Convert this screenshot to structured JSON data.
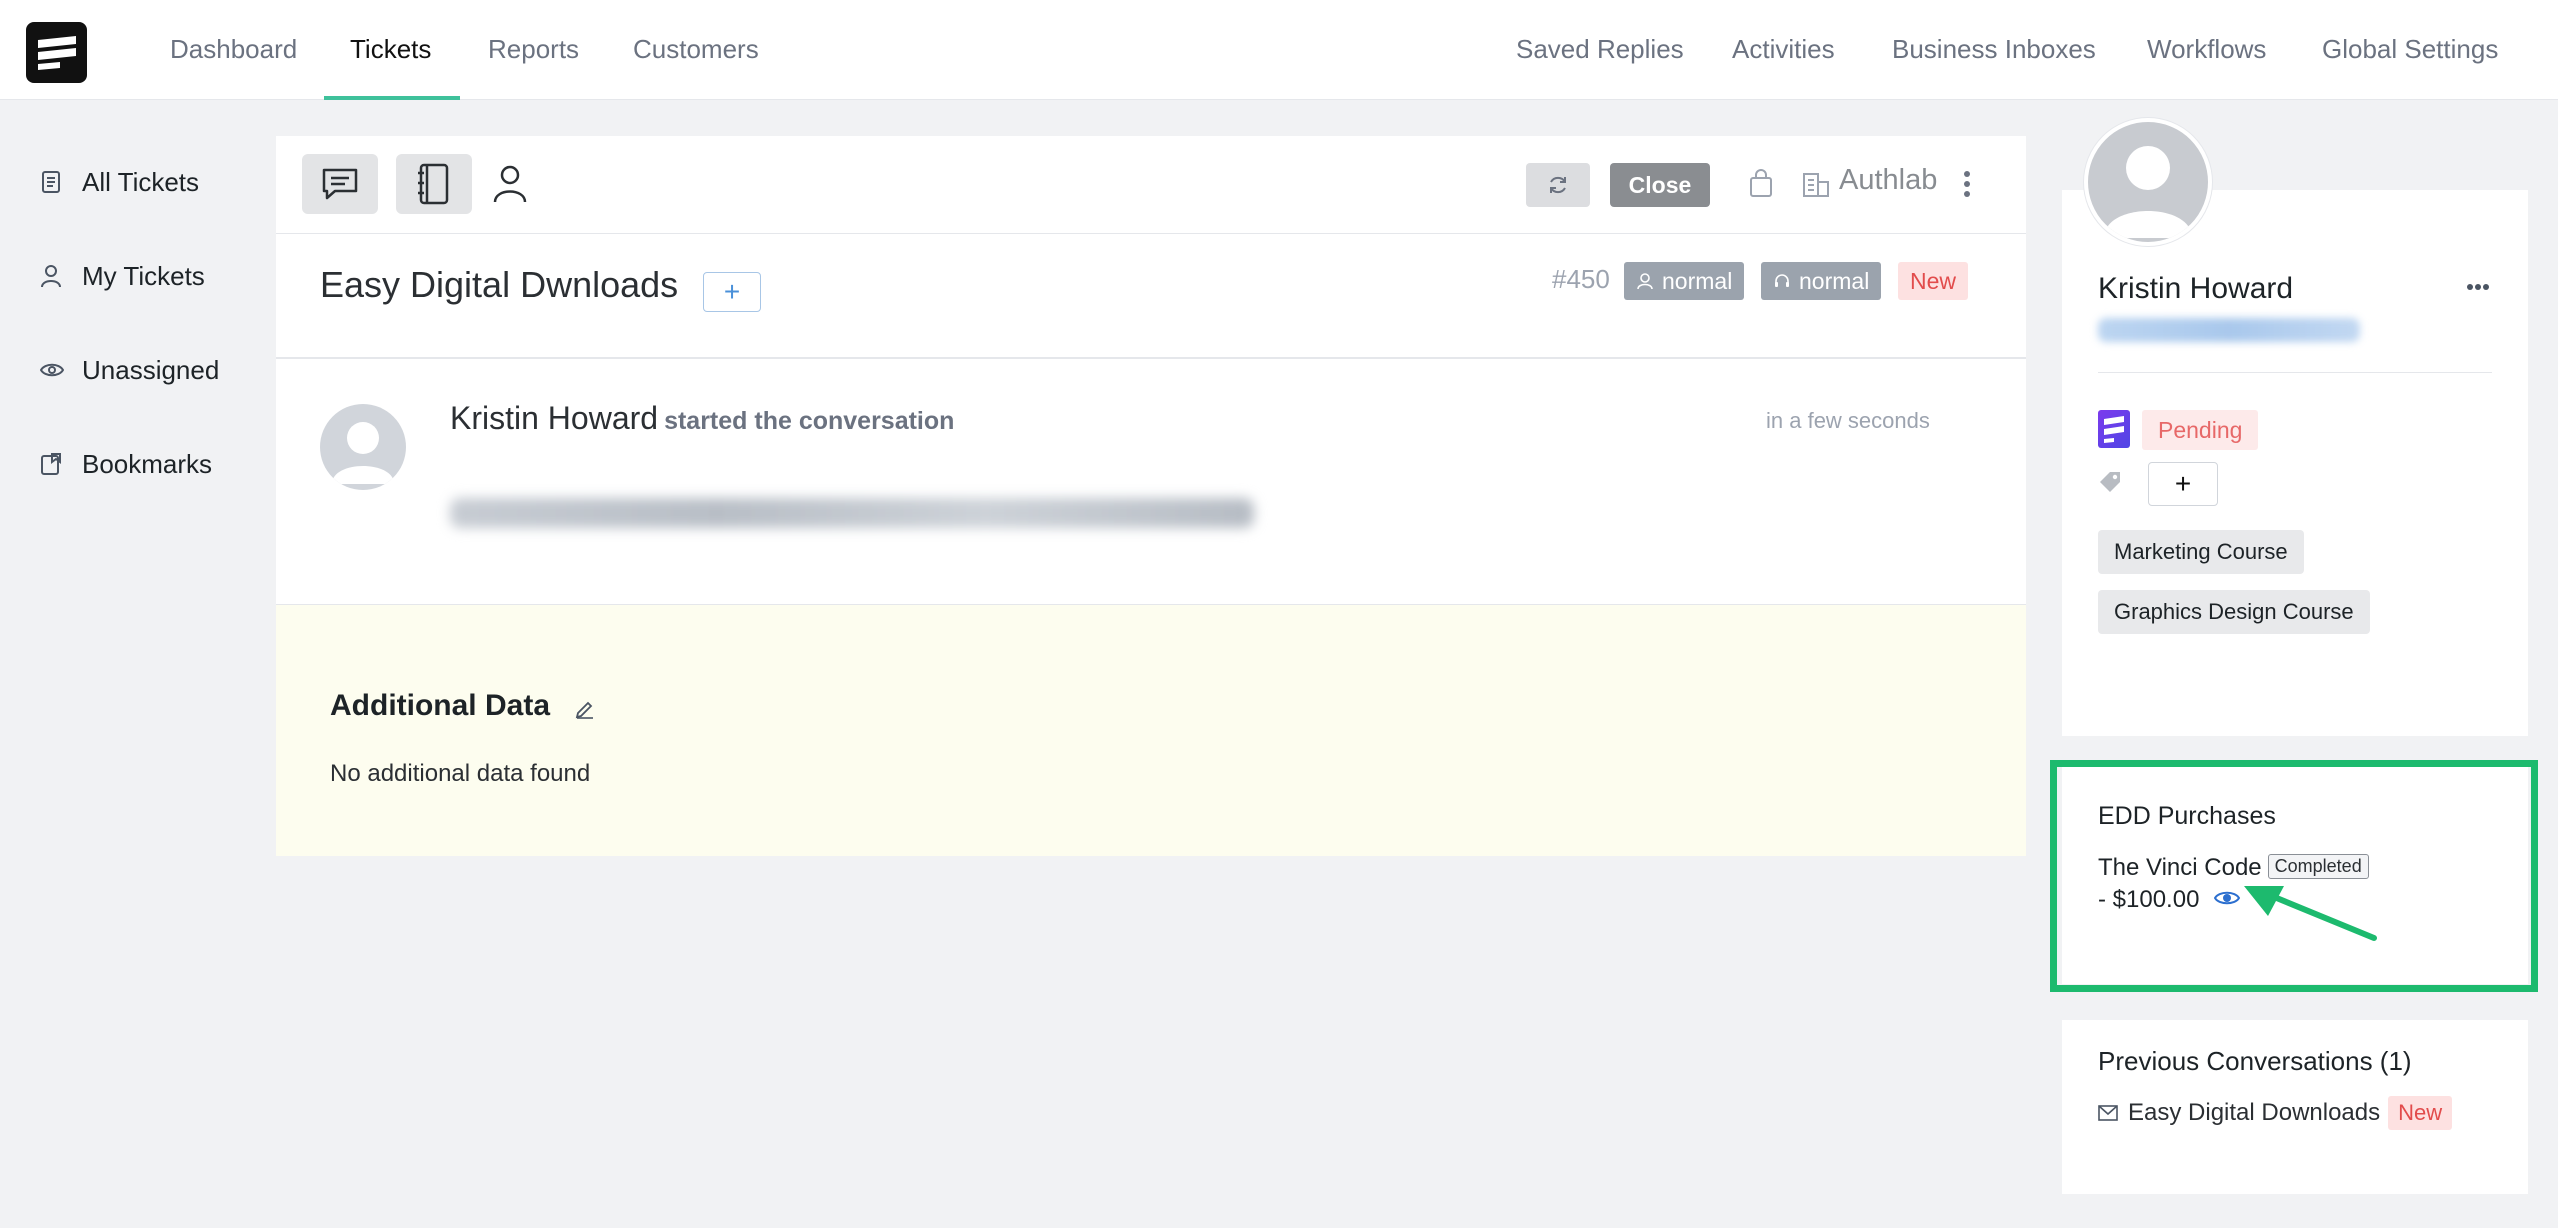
{
  "nav": {
    "left": [
      "Dashboard",
      "Tickets",
      "Reports",
      "Customers"
    ],
    "active": "Tickets",
    "right": [
      "Saved Replies",
      "Activities",
      "Business Inboxes",
      "Workflows",
      "Global Settings"
    ]
  },
  "sidebar": {
    "items": [
      {
        "label": "All Tickets",
        "icon": "document-icon"
      },
      {
        "label": "My Tickets",
        "icon": "user-icon"
      },
      {
        "label": "Unassigned",
        "icon": "eye-icon"
      },
      {
        "label": "Bookmarks",
        "icon": "bookmark-icon"
      }
    ]
  },
  "toolbar": {
    "close_label": "Close",
    "inbox_name": "Authlab"
  },
  "ticket": {
    "title": "Easy Digital Dwnloads",
    "add_label": "+",
    "number": "#450",
    "priority_customer": "normal",
    "priority_agent": "normal",
    "status": "New"
  },
  "conversation": {
    "author": "Kristin Howard",
    "action": "started the conversation",
    "time": "in a few seconds"
  },
  "additional_data": {
    "heading": "Additional Data",
    "empty_text": "No additional data found"
  },
  "customer": {
    "name": "Kristin Howard",
    "status": "Pending",
    "add_tag_label": "+",
    "courses": [
      "Marketing Course",
      "Graphics Design Course"
    ]
  },
  "edd": {
    "title": "EDD Purchases",
    "product": "The Vinci Code",
    "status": "Completed",
    "price": "- $100.00"
  },
  "previous": {
    "title": "Previous Conversations (1)",
    "item_label": "Easy Digital Downloads",
    "item_status": "New"
  },
  "colors": {
    "accent": "#3ec19b",
    "highlight": "#1dba6e",
    "new_badge": "#e24c4c"
  }
}
